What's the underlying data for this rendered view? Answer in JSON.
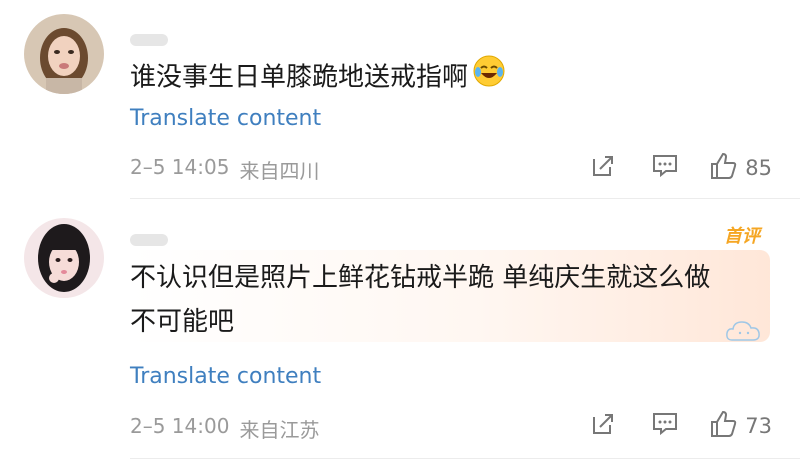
{
  "comments": [
    {
      "text": "谁没事生日单膝跪地送戒指啊",
      "emoji": "crying-laughing-emoji",
      "translate": "Translate content",
      "date": "2–5 14:05",
      "location": "来自四川",
      "likes": "85"
    },
    {
      "badge": "首评",
      "text_line1": "不认识但是照片上鲜花钻戒半跪 单纯庆生就这么做",
      "text_line2": "不可能吧",
      "translate": "Translate content",
      "date": "2–5 14:00",
      "location": "来自江苏",
      "likes": "73"
    }
  ],
  "icons": {
    "share": "share-icon",
    "comment": "comment-icon",
    "like": "thumbs-up-icon"
  },
  "colors": {
    "link": "#3f7fbf",
    "meta": "#9a9a9a",
    "badge": "#f5a623"
  }
}
